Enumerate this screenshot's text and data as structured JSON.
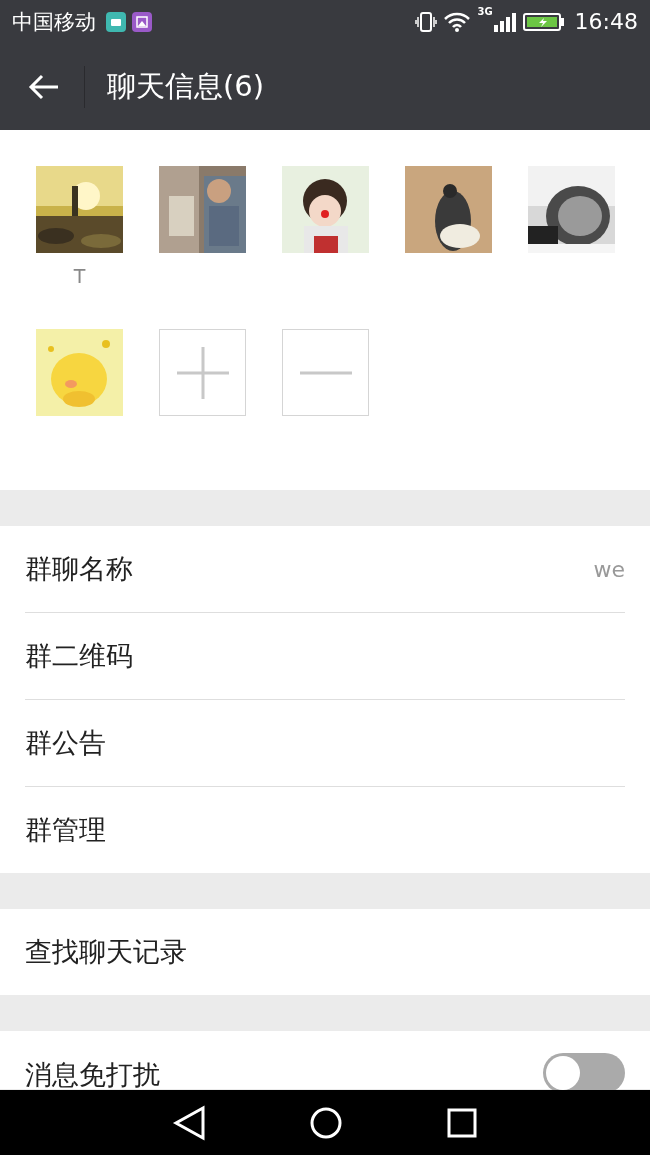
{
  "status_bar": {
    "carrier": "中国移动",
    "network": "3G",
    "time": "16:48"
  },
  "header": {
    "title": "聊天信息(6)"
  },
  "members": [
    {
      "kind": "picture",
      "name": "T"
    },
    {
      "kind": "picture"
    },
    {
      "kind": "picture"
    },
    {
      "kind": "picture"
    },
    {
      "kind": "picture"
    },
    {
      "kind": "picture"
    },
    {
      "kind": "add"
    },
    {
      "kind": "remove"
    }
  ],
  "sections": [
    [
      {
        "kind": "link",
        "label": "群聊名称",
        "value": "we"
      },
      {
        "kind": "link",
        "label": "群二维码"
      },
      {
        "kind": "link",
        "label": "群公告"
      },
      {
        "kind": "link",
        "label": "群管理"
      }
    ],
    [
      {
        "kind": "link",
        "label": "查找聊天记录"
      }
    ],
    [
      {
        "kind": "toggle",
        "label": "消息免打扰",
        "on": false
      }
    ]
  ]
}
